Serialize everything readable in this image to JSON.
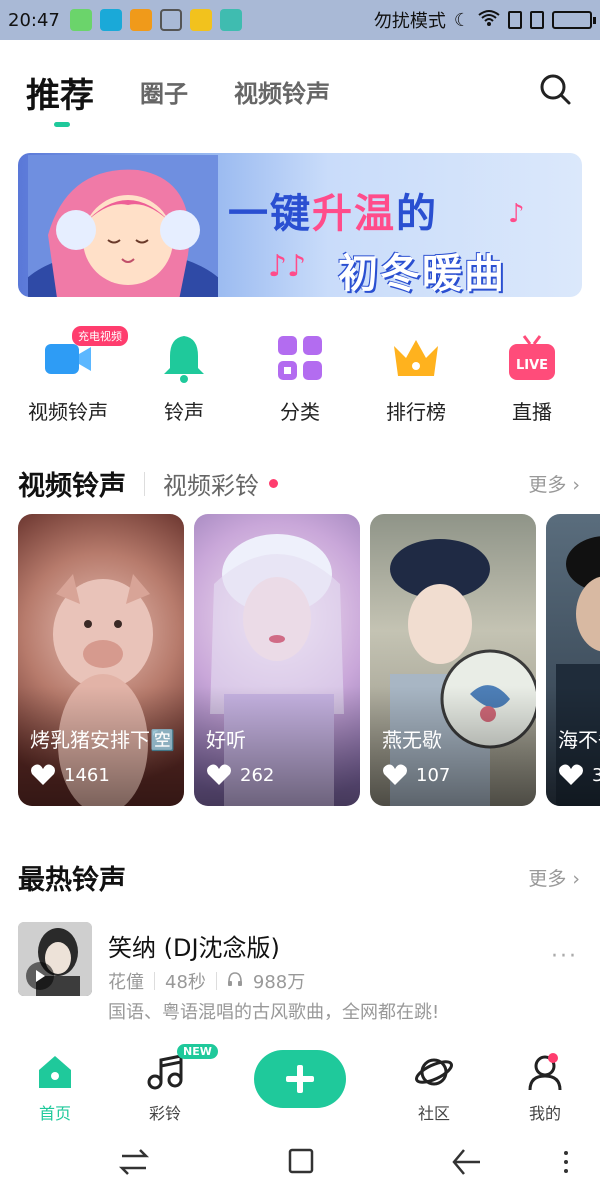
{
  "status_bar": {
    "time": "20:47",
    "dnd_label": "勿扰模式"
  },
  "top_tabs": [
    {
      "label": "推荐"
    },
    {
      "label": "圈子"
    },
    {
      "label": "视频铃声"
    }
  ],
  "banner": {
    "line1_a": "一键",
    "line1_b": "升温",
    "line1_c": "的",
    "line2": "初冬暖曲",
    "notes": "♪♪",
    "note2": "♪"
  },
  "categories": [
    {
      "label": "视频铃声",
      "badge": "充电视频",
      "icon": "video-icon"
    },
    {
      "label": "铃声",
      "icon": "bell-icon"
    },
    {
      "label": "分类",
      "icon": "grid-icon"
    },
    {
      "label": "排行榜",
      "icon": "crown-icon"
    },
    {
      "label": "直播",
      "icon": "live-tv-icon",
      "icon_text": "LIVE"
    }
  ],
  "video_section": {
    "title": "视频铃声",
    "subtitle": "视频彩铃",
    "more": "更多 ›"
  },
  "video_cards": [
    {
      "title": "烤乳猪安排下🈳",
      "likes": "1461"
    },
    {
      "title": "好听",
      "likes": "262"
    },
    {
      "title": "燕无歇",
      "likes": "107"
    },
    {
      "title": "海不争",
      "likes": "3"
    }
  ],
  "hot_section": {
    "title": "最热铃声",
    "more": "更多 ›"
  },
  "song": {
    "name": "笑纳 (DJ沈念版)",
    "artist": "花僮",
    "duration": "48秒",
    "plays": "988万",
    "desc": "国语、粤语混唱的古风歌曲，全网都在跳!",
    "menu": "···"
  },
  "bottom_nav": [
    {
      "label": "首页",
      "icon": "home-icon"
    },
    {
      "label": "彩铃",
      "icon": "music-note-icon",
      "badge": "NEW"
    },
    {
      "label": "社区",
      "icon": "planet-icon"
    },
    {
      "label": "我的",
      "icon": "profile-icon"
    }
  ],
  "colors": {
    "accent": "#1fc99b",
    "badge_red": "#ff3d6e"
  }
}
